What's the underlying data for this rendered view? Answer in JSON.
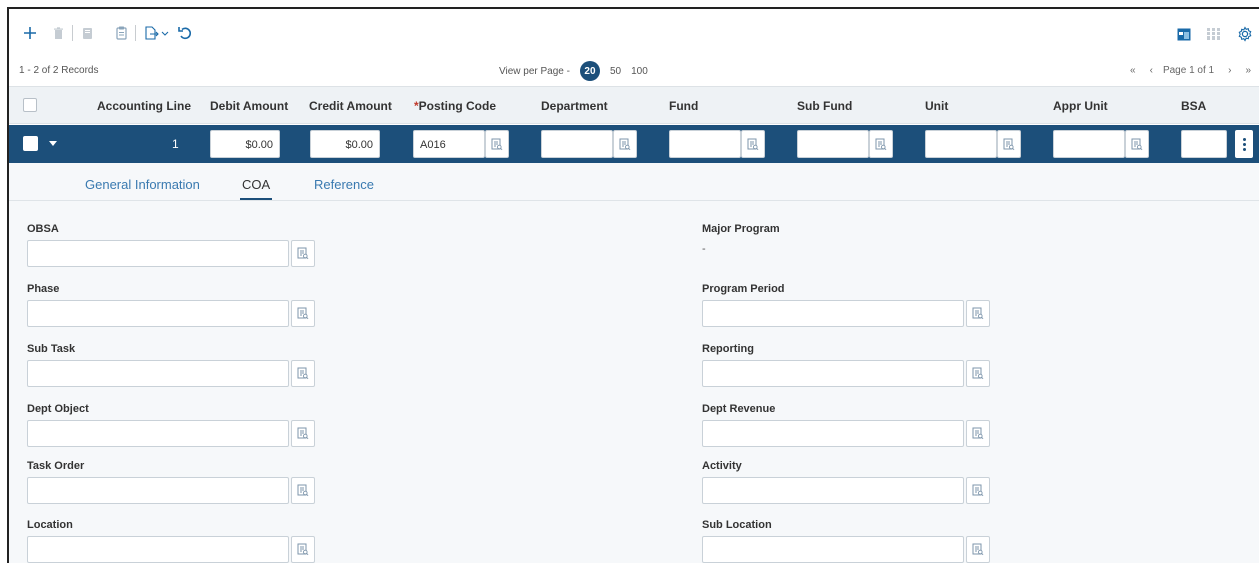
{
  "toolbar": {
    "left_icons": [
      "add-icon",
      "delete-icon",
      "copy-icon",
      "paste-icon",
      "export-icon",
      "undo-icon"
    ],
    "right_icons": [
      "grid-view-icon",
      "column-settings-icon",
      "settings-icon"
    ]
  },
  "pager": {
    "records": "1 - 2 of 2 Records",
    "view_per_page_label": "View per Page -",
    "options": [
      "20",
      "50",
      "100"
    ],
    "selected": "20",
    "page_label": "Page 1 of 1"
  },
  "grid": {
    "columns": [
      "Accounting Line",
      "Debit Amount",
      "Credit Amount",
      "Posting Code",
      "Department",
      "Fund",
      "Sub Fund",
      "Unit",
      "Appr Unit",
      "BSA"
    ],
    "required_marker": "*",
    "row": {
      "accounting_line": "1",
      "debit_amount": "$0.00",
      "credit_amount": "$0.00",
      "posting_code": "A016"
    }
  },
  "detail": {
    "tabs": [
      "General Information",
      "COA",
      "Reference"
    ],
    "active_tab": "COA",
    "left_fields": [
      "OBSA",
      "Phase",
      "Sub Task",
      "Dept Object",
      "Task Order",
      "Location"
    ],
    "right_fields": {
      "major_program": {
        "label": "Major Program",
        "value": "-"
      },
      "program_period": "Program Period",
      "reporting": "Reporting",
      "dept_revenue": "Dept Revenue",
      "activity": "Activity",
      "sub_location": "Sub Location"
    }
  },
  "colors": {
    "primary": "#1c4f7a",
    "accent": "#1a6aa8",
    "header_bg": "#eef2f5",
    "panel_bg": "#f6f8fa"
  }
}
